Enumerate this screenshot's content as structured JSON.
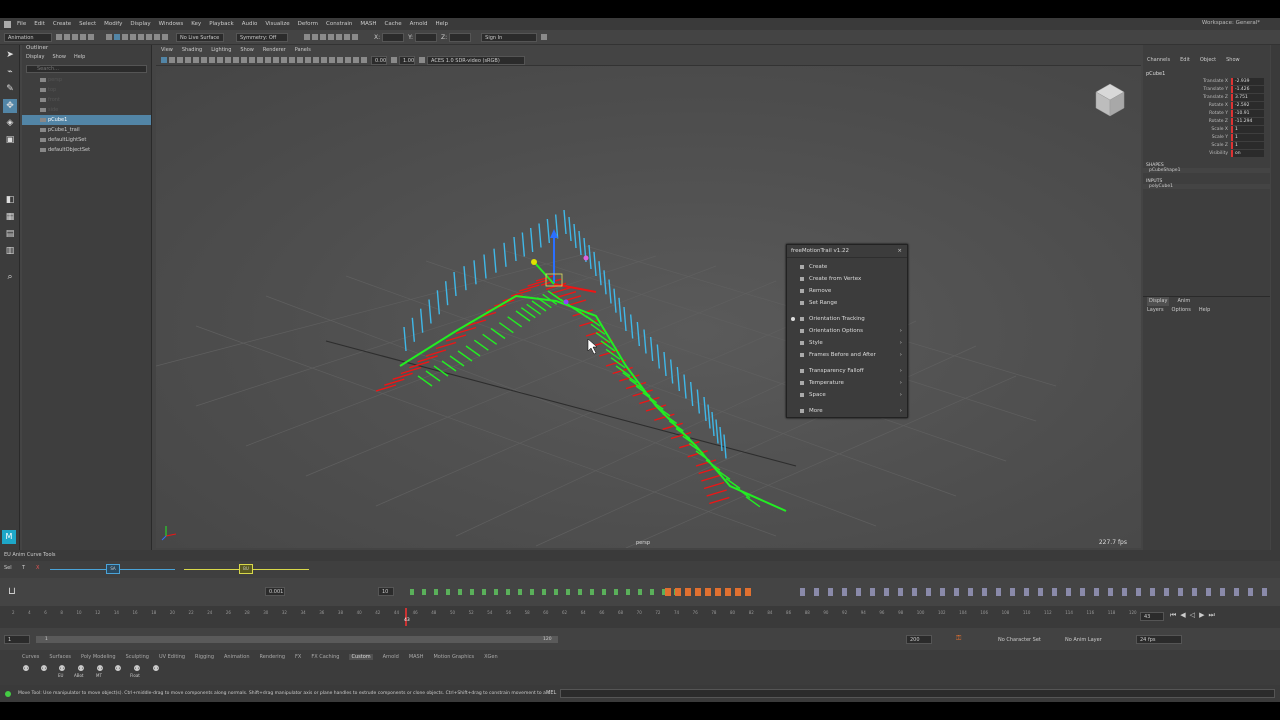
{
  "menubar": {
    "items": [
      "File",
      "Edit",
      "Create",
      "Select",
      "Modify",
      "Display",
      "Windows",
      "Key",
      "Playback",
      "Audio",
      "Visualize",
      "Deform",
      "Constrain",
      "MASH",
      "Cache",
      "Arnold",
      "Help"
    ],
    "workspace": "Workspace: General*"
  },
  "statusline": {
    "mode": "Animation",
    "live_surface": "No Live Surface",
    "symmetry": "Symmetry: Off",
    "sign_in": "Sign In",
    "x": "X:",
    "y": "Y:",
    "z": "Z:"
  },
  "outliner": {
    "title": "Outliner",
    "menus": [
      "Display",
      "Show",
      "Help"
    ],
    "search_placeholder": "Search...",
    "items": [
      {
        "label": "persp",
        "dim": true
      },
      {
        "label": "top",
        "dim": true
      },
      {
        "label": "front",
        "dim": true
      },
      {
        "label": "side",
        "dim": true
      },
      {
        "label": "pCube1",
        "selected": true
      },
      {
        "label": "pCube1_trail"
      },
      {
        "label": "defaultLightSet"
      },
      {
        "label": "defaultObjectSet"
      }
    ]
  },
  "viewport": {
    "menus": [
      "View",
      "Shading",
      "Lighting",
      "Show",
      "Renderer",
      "Panels"
    ],
    "exposure": "0.00",
    "gamma": "1.00",
    "colorspace": "ACES 1.0 SDR-video (sRGB)",
    "camera": "persp",
    "fps": "227.7 fps"
  },
  "popup": {
    "title": "freeMotionTrail v1.22",
    "close": "×",
    "items": [
      {
        "label": "Create",
        "submenu": false
      },
      {
        "label": "Create from Vertex",
        "submenu": false
      },
      {
        "label": "Remove",
        "submenu": false
      },
      {
        "label": "Set Range",
        "submenu": false
      },
      {
        "label": "Orientation Tracking",
        "submenu": false,
        "checked": true
      },
      {
        "label": "Orientation Options",
        "submenu": true
      },
      {
        "label": "Style",
        "submenu": true
      },
      {
        "label": "Frames Before and After",
        "submenu": true
      },
      {
        "label": "Transparency Falloff",
        "submenu": true
      },
      {
        "label": "Temperature",
        "submenu": true
      },
      {
        "label": "Space",
        "submenu": true
      },
      {
        "label": "More",
        "submenu": true
      }
    ],
    "arrow": "›"
  },
  "channelbox": {
    "menus": [
      "Channels",
      "Edit",
      "Object",
      "Show"
    ],
    "node": "pCube1",
    "channels": [
      {
        "label": "Translate X",
        "value": "-2.939"
      },
      {
        "label": "Translate Y",
        "value": "-1.426"
      },
      {
        "label": "Translate Z",
        "value": "3.751"
      },
      {
        "label": "Rotate X",
        "value": "-2.592"
      },
      {
        "label": "Rotate Y",
        "value": "-10.91"
      },
      {
        "label": "Rotate Z",
        "value": "-11.294"
      },
      {
        "label": "Scale X",
        "value": "1"
      },
      {
        "label": "Scale Y",
        "value": "1"
      },
      {
        "label": "Scale Z",
        "value": "1"
      },
      {
        "label": "Visibility",
        "value": "on"
      }
    ],
    "shapes_label": "SHAPES",
    "shape": "pCubeShape1",
    "inputs_label": "INPUTS",
    "input": "polyCube1"
  },
  "layers": {
    "tabs": [
      "Display",
      "Anim"
    ],
    "menus": [
      "Layers",
      "Options",
      "Help"
    ]
  },
  "eu": {
    "title": "EU Anim Curve Tools",
    "set": "Sel",
    "t": "T",
    "x": "X",
    "slider1": "SA",
    "slider2": "BU"
  },
  "animtools": {
    "value1": "0.001",
    "value2": "10",
    "ticks": [
      "2",
      "4",
      "6",
      "8",
      "10",
      "12",
      "14",
      "16",
      "18",
      "20",
      "22",
      "24",
      "26",
      "28",
      "30",
      "32",
      "34",
      "36",
      "38",
      "40",
      "42",
      "44",
      "46",
      "48",
      "50",
      "52",
      "54",
      "56",
      "58",
      "60",
      "62",
      "64",
      "66",
      "68",
      "70",
      "72",
      "74",
      "76",
      "78",
      "80",
      "82",
      "84",
      "86",
      "88",
      "90",
      "92",
      "94",
      "96",
      "98",
      "100",
      "102",
      "104",
      "106",
      "108",
      "110",
      "112",
      "114",
      "116",
      "118",
      "120"
    ],
    "current_frame": "43",
    "frame_field": "43"
  },
  "range": {
    "start": "1",
    "start2": "1",
    "end_inner": "120",
    "end": "200",
    "character_set": "No Character Set",
    "anim_layer": "No Anim Layer",
    "fps": "24 fps"
  },
  "shelf": {
    "tabs": [
      "Curves",
      "Surfaces",
      "Poly Modeling",
      "Sculpting",
      "UV Editing",
      "Rigging",
      "Animation",
      "Rendering",
      "FX",
      "FX Caching",
      "Custom",
      "Arnold",
      "MASH",
      "Motion Graphics",
      "XGen"
    ],
    "active": "Custom",
    "buttons": [
      "EU",
      "ABot",
      "MT",
      "Float"
    ]
  },
  "helpline": {
    "text": "Move Tool: Use manipulator to move object(s). Ctrl+middle-drag to move components along normals. Shift+drag manipulator axis or plane handles to extrude components or clone objects. Ctrl+Shift+drag to constrain movement to a c",
    "mel": "MEL"
  }
}
